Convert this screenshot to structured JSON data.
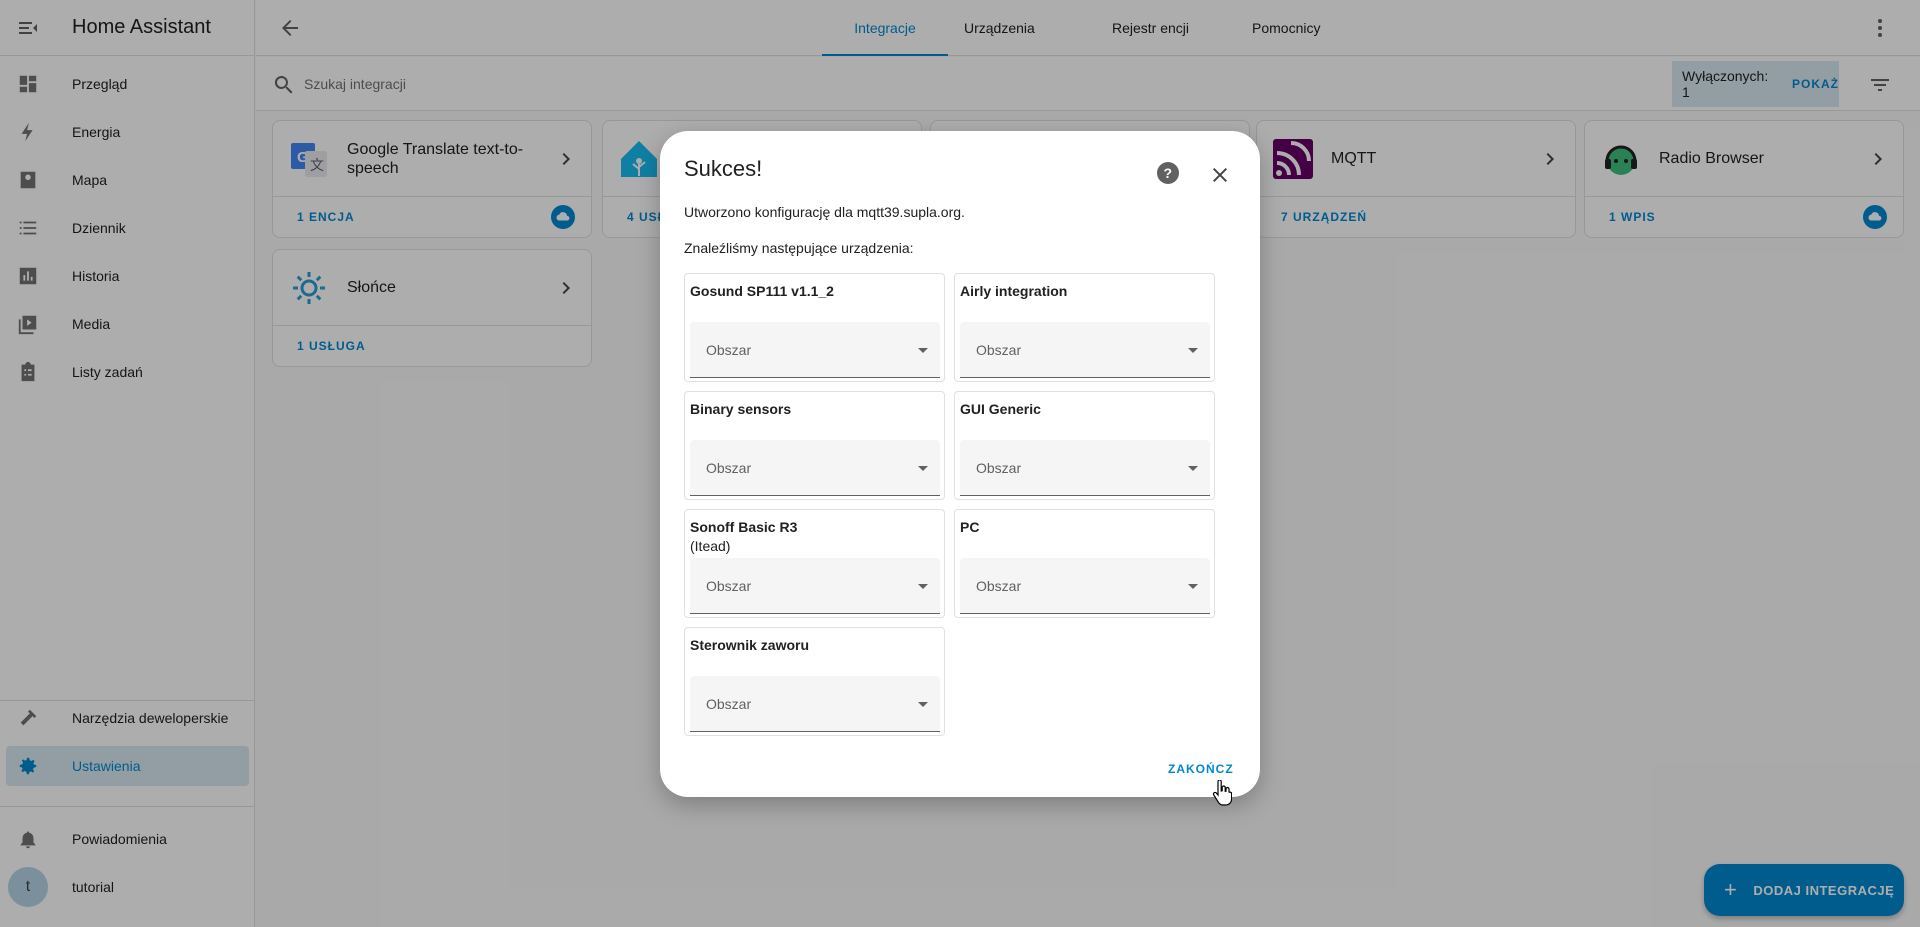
{
  "app": {
    "title": "Home Assistant"
  },
  "sidebar": {
    "items": [
      {
        "label": "Przegląd",
        "icon": "dashboard-icon"
      },
      {
        "label": "Energia",
        "icon": "lightning-icon"
      },
      {
        "label": "Mapa",
        "icon": "map-icon"
      },
      {
        "label": "Dziennik",
        "icon": "logbook-icon"
      },
      {
        "label": "Historia",
        "icon": "history-chart-icon"
      },
      {
        "label": "Media",
        "icon": "media-icon"
      },
      {
        "label": "Listy zadań",
        "icon": "clipboard-list-icon"
      }
    ],
    "developer_tools": "Narzędzia deweloperskie",
    "settings": "Ustawienia",
    "notifications": "Powiadomienia",
    "user": {
      "name": "tutorial",
      "initial": "t"
    }
  },
  "tabs": [
    "Integracje",
    "Urządzenia",
    "Rejestr encji",
    "Pomocnicy"
  ],
  "search": {
    "placeholder": "Szukaj integracji"
  },
  "disabled_chip": {
    "label": "Wyłączonych: 1",
    "button": "POKAŻ"
  },
  "cards": [
    {
      "title": "Google Translate text-to-speech",
      "footer": "1 ENCJA",
      "cloud": true
    },
    {
      "title": "",
      "footer": "4 USŁ"
    },
    {
      "title": "MQTT",
      "footer": "7 URZĄDZEŃ"
    },
    {
      "title": "Radio Browser",
      "footer": "1 WPIS",
      "cloud": true
    },
    {
      "title": "Słońce",
      "footer": "1 USŁUGA"
    }
  ],
  "dialog": {
    "title": "Sukces!",
    "created_text": "Utworzono konfigurację dla mqtt39.supla.org.",
    "found_text": "Znaleźliśmy następujące urządzenia:",
    "area_label": "Obszar",
    "devices": [
      {
        "name": "Gosund SP111 v1.1_2",
        "sub": ""
      },
      {
        "name": "Airly integration",
        "sub": ""
      },
      {
        "name": "Binary sensors",
        "sub": ""
      },
      {
        "name": "GUI Generic",
        "sub": ""
      },
      {
        "name": "Sonoff Basic R3",
        "sub": "(Itead)"
      },
      {
        "name": "PC",
        "sub": ""
      },
      {
        "name": "Sterownik zaworu",
        "sub": ""
      }
    ],
    "finish_button": "ZAKOŃCZ"
  },
  "fab": {
    "label": "DODAJ INTEGRACJĘ"
  },
  "colors": {
    "accent": "#0288d1",
    "active_bg": "#d9e9f2",
    "mqtt": "#660066"
  }
}
